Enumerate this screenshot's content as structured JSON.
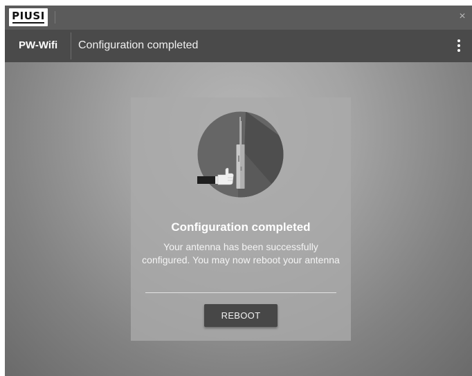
{
  "window": {
    "logo_text": "PIUSI",
    "close_glyph": "×"
  },
  "appbar": {
    "brand": "PW-Wifi",
    "title": "Configuration completed",
    "menu_icon": "more-vert-icon"
  },
  "card": {
    "illustration_icon": "antenna-thumbs-up-icon",
    "title": "Configuration completed",
    "message": "Your antenna has been successfully configured. You may now reboot your antenna",
    "reboot_label": "REBOOT"
  }
}
